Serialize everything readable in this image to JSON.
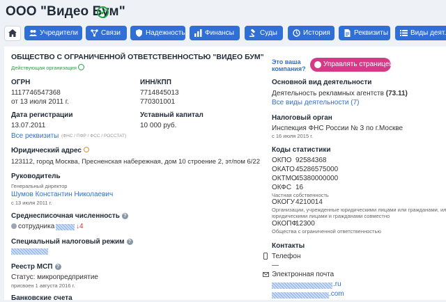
{
  "header": {
    "title": "ООО \"Видео Бум\""
  },
  "tabs": [
    "Учредители",
    "Связи",
    "Надежность",
    "Финансы",
    "Суды",
    "История",
    "Реквизиты",
    "Виды деят."
  ],
  "company": {
    "full_name": "ОБЩЕСТВО С ОГРАНИЧЕННОЙ ОТВЕТСТВЕННОСТЬЮ \"ВИДЕО БУМ\"",
    "status": "Действующая организация"
  },
  "ogrn": {
    "label": "ОГРН",
    "value": "1117746547368",
    "date": "от 13 июля 2011 г."
  },
  "inn": {
    "label": "ИНН/КПП",
    "inn": "7714845013",
    "kpp": "770301001"
  },
  "reg": {
    "label": "Дата регистрации",
    "value": "13.07.2011"
  },
  "capital": {
    "label": "Уставный капитал",
    "value": "10 000 руб."
  },
  "requisites": {
    "link": "Все реквизиты",
    "note": "(ФНС / ПФР / ФСС / РОССТАТ)"
  },
  "address": {
    "label": "Юридический адрес",
    "value": "123112, город Москва, Пресненская набережная, дом 10 строение 2, эт/пом 6/22"
  },
  "head": {
    "label": "Руководитель",
    "role": "Генеральный директор",
    "name": "Шумов Константин Николаевич",
    "date": "с 13 июля 2011 г."
  },
  "staff": {
    "label": "Среднесписочная численность",
    "value": "сотрудника в",
    "delta": "↓4"
  },
  "tax_mode": {
    "label": "Специальный налоговый режим"
  },
  "msp": {
    "label": "Реестр МСП",
    "status": "Статус: микропредприятие",
    "date": "присвоен 1 августа 2016 г."
  },
  "bank": {
    "label": "Банковские счета"
  },
  "right": {
    "owner_q1": "Это ваша",
    "owner_q2": "компания?",
    "manage": "Управлять страницей",
    "activity_label": "Основной вид деятельности",
    "activity": "Деятельность рекламных агентств",
    "activity_code": "(73.11)",
    "activity_link": "Все виды деятельности (7)",
    "tax_label": "Налоговый орган",
    "tax_value": "Инспекция ФНС России № 3 по г.Москве",
    "tax_date": "с 16 июля 2015 г.",
    "codes_label": "Коды статистики",
    "codes": [
      {
        "k": "ОКПО",
        "v": "92584368"
      },
      {
        "k": "ОКАТО",
        "v": "45286575000"
      },
      {
        "k": "ОКТМО",
        "v": "45380000000"
      },
      {
        "k": "ОКФС",
        "v": "16"
      }
    ],
    "okfs_note": "Частная собственность",
    "okogu": {
      "k": "ОКОГУ",
      "v": "4210014"
    },
    "okogu_note1": "Организации, учрежденные юридическими лицами или гражданами, или",
    "okogu_note2": "юридическими лицами и гражданами совместно",
    "okopf": {
      "k": "ОКОПФ",
      "v": "12300"
    },
    "okopf_note": "Общества с ограниченной ответственностью",
    "contacts_label": "Контакты",
    "phone_label": "Телефон",
    "phone_value": "—",
    "email_label": "Электронная почта",
    "email1_tail": ".ru",
    "email2_tail": ".com"
  }
}
